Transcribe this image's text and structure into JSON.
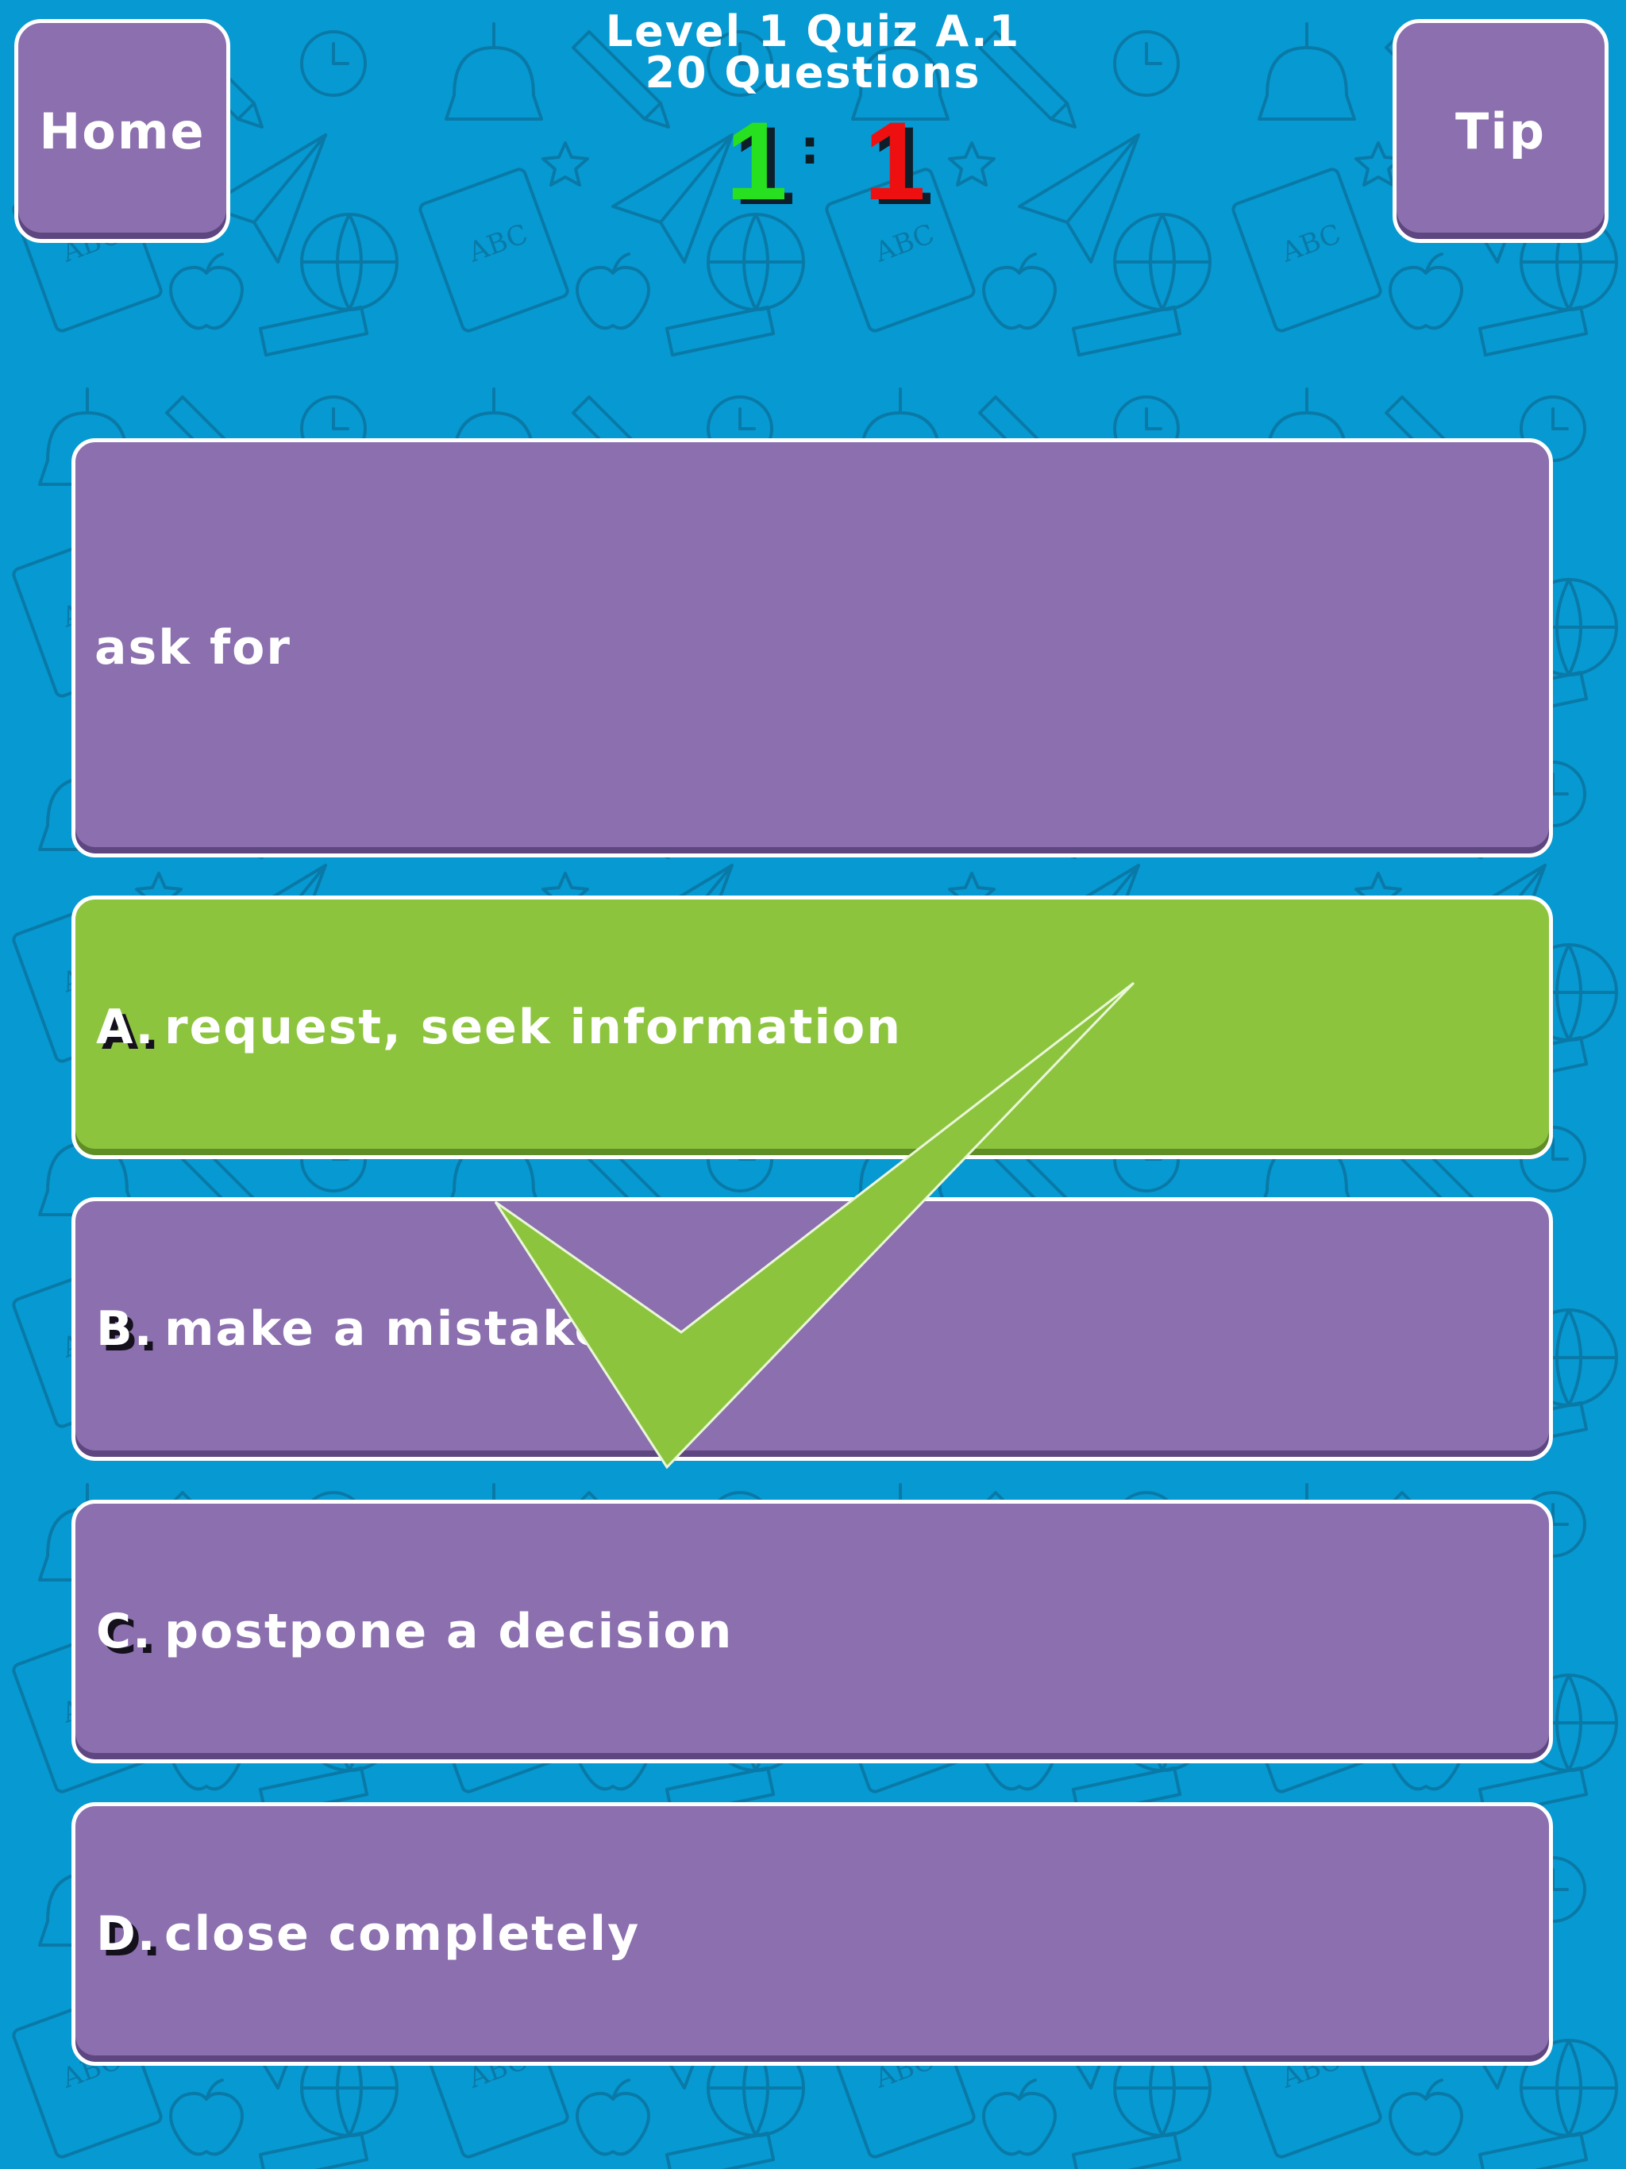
{
  "nav": {
    "home_label": "Home",
    "tip_label": "Tip"
  },
  "header": {
    "title": "Level 1 Quiz A.1",
    "question_count": "20 Questions"
  },
  "score": {
    "correct": "1",
    "separator": ":",
    "wrong": "1"
  },
  "question": {
    "text": "ask for"
  },
  "answers": [
    {
      "letter": "A.",
      "text": "request, seek information",
      "state": "correct"
    },
    {
      "letter": "B.",
      "text": "make a mistake",
      "state": "default"
    },
    {
      "letter": "C.",
      "text": "postpone a decision",
      "state": "default"
    },
    {
      "letter": "D.",
      "text": "close completely",
      "state": "default"
    }
  ],
  "colors": {
    "background": "#0799d1",
    "button": "#8b6fae",
    "correct": "#8cc43e",
    "score_correct": "#27e01f",
    "score_wrong": "#ee1010"
  },
  "icons": {
    "result": "checkmark-icon",
    "background": "school-supplies-pattern"
  }
}
